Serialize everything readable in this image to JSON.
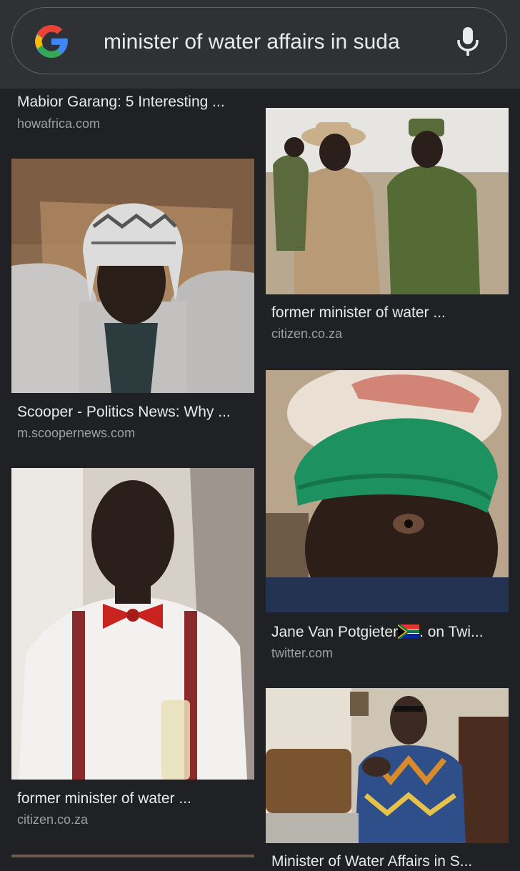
{
  "search": {
    "query": "minister of water affairs in suda"
  },
  "results": [
    {
      "title": "Mabior Garang: 5 Interesting ...",
      "domain": "howafrica.com"
    },
    {
      "title": "Scooper - Politics News: Why ...",
      "domain": "m.scoopernews.com"
    },
    {
      "title": "former minister of water ...",
      "domain": "citizen.co.za"
    },
    {
      "title": "former minister of water ...",
      "domain": "citizen.co.za"
    },
    {
      "title_before_flag": "Jane Van Potgieter",
      "title_after_flag": ". on Twi...",
      "domain": "twitter.com"
    },
    {
      "title": "Minister of Water Affairs in S..."
    }
  ],
  "icons": {
    "logo": "google-g-logo",
    "mic": "microphone-icon",
    "flag": "south-africa-flag-icon"
  },
  "colors": {
    "background": "#202124",
    "header": "#303134",
    "text": "#e8eaed",
    "domain_text": "#9aa0a6"
  }
}
